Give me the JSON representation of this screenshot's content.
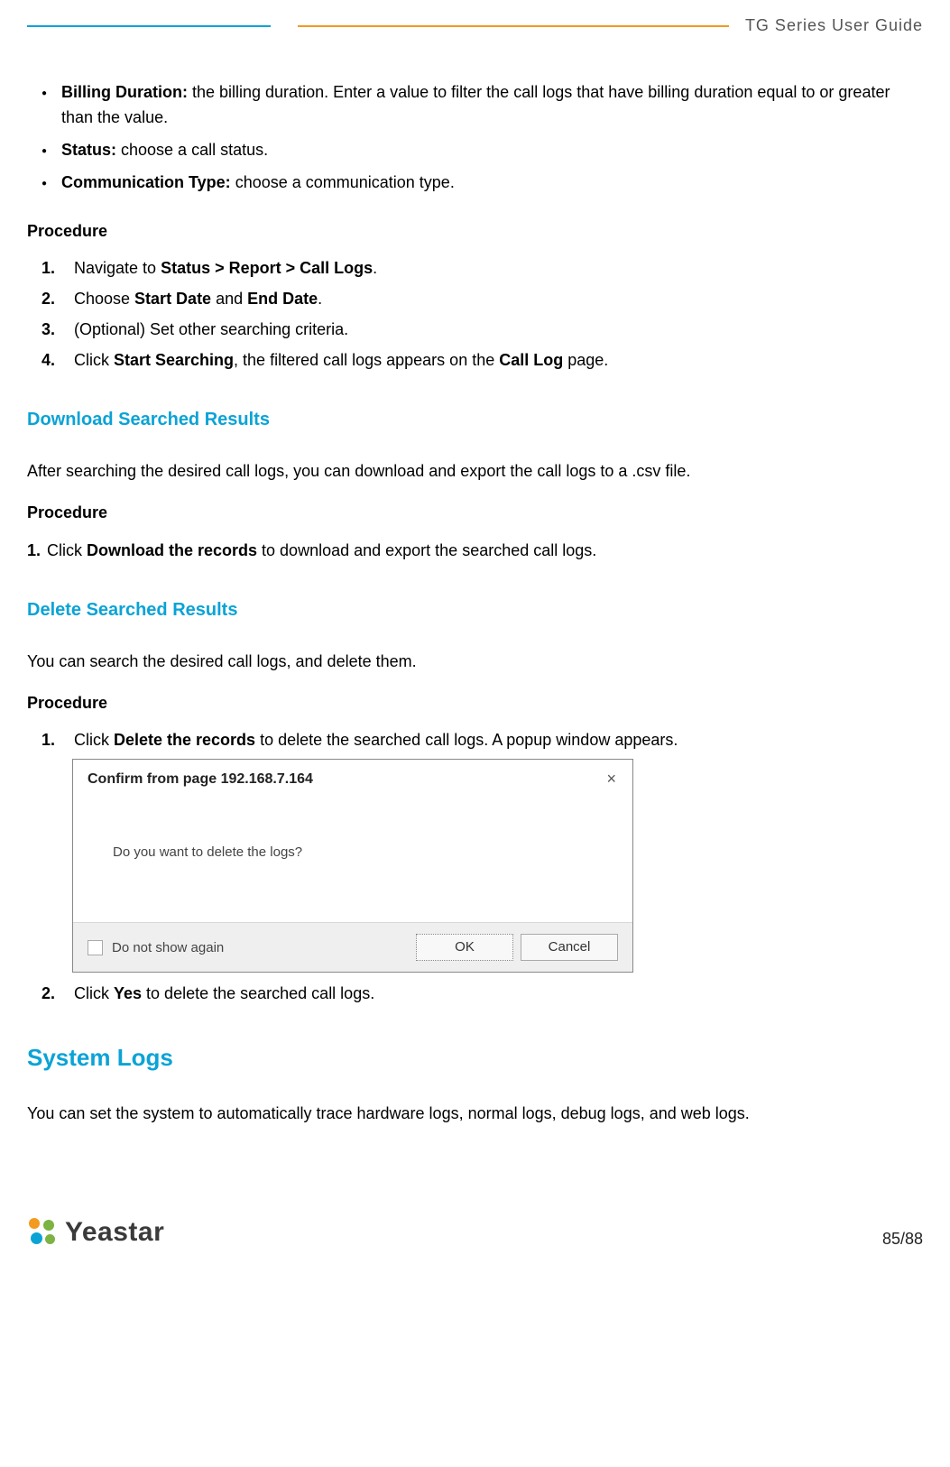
{
  "header": {
    "title": "TG  Series  User  Guide"
  },
  "bullets": [
    {
      "bold": "Billing Duration:",
      "text": " the billing duration. Enter a value to filter the call logs that have billing duration equal to or greater than the value."
    },
    {
      "bold": "Status:",
      "text": " choose a call status."
    },
    {
      "bold": "Communication Type:",
      "text": " choose a communication type."
    }
  ],
  "procedure_label": "Procedure",
  "proc1": [
    {
      "n": "1.",
      "pre": "Navigate to ",
      "b1": "Status > Report > Call Logs",
      "post": "."
    },
    {
      "n": "2.",
      "pre": "Choose ",
      "b1": "Start Date",
      "mid": " and ",
      "b2": "End Date",
      "post": "."
    },
    {
      "n": "3.",
      "pre": "(Optional) Set other searching criteria.",
      "b1": "",
      "post": ""
    },
    {
      "n": "4.",
      "pre": "Click ",
      "b1": "Start Searching",
      "mid": ", the filtered call logs appears on the ",
      "b2": "Call Log",
      "post": " page."
    }
  ],
  "download": {
    "heading": "Download Searched Results",
    "intro": "After searching the desired call logs, you can download and export the call logs to a .csv file.",
    "step_n": "1.",
    "step_pre": " Click ",
    "step_b": "Download the records",
    "step_post": " to download and export the searched call logs."
  },
  "delete": {
    "heading": "Delete Searched Results",
    "intro": "You can search the desired call logs, and delete them.",
    "step1_n": "1.",
    "step1_pre": "Click ",
    "step1_b": "Delete the records",
    "step1_post": " to delete the searched call logs. A popup window appears.",
    "step2_n": "2.",
    "step2_pre": "Click ",
    "step2_b": "Yes",
    "step2_post": " to delete the searched call logs."
  },
  "dialog": {
    "title": "Confirm from page 192.168.7.164",
    "message": "Do you want to delete the logs?",
    "dont_show": "Do not show again",
    "ok": "OK",
    "cancel": "Cancel"
  },
  "syslogs": {
    "heading": "System Logs",
    "intro": "You can set the system to automatically trace hardware logs, normal logs, debug logs, and web logs."
  },
  "footer": {
    "brand": "Yeastar",
    "page": "85/88"
  }
}
